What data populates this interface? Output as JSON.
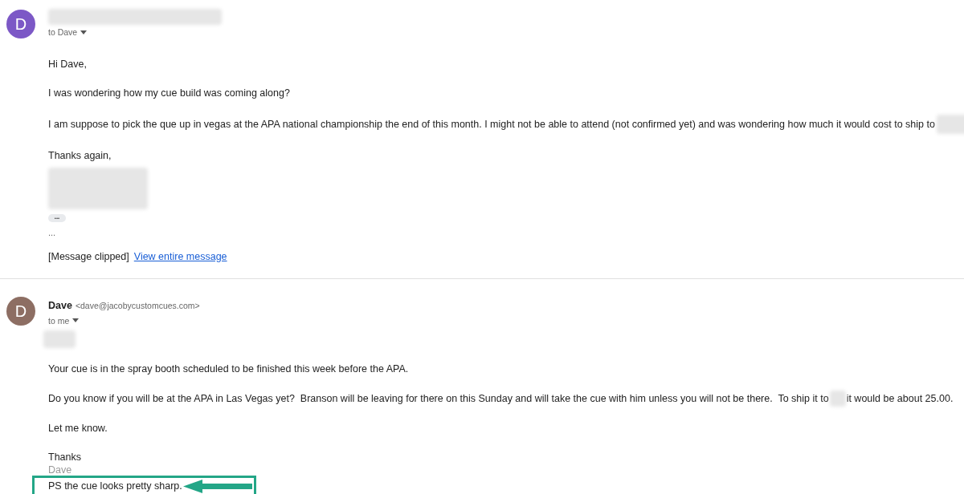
{
  "messages": [
    {
      "avatar_letter": "D",
      "color": "#7c58c6",
      "recipient": "to Dave",
      "body": [
        {
          "kind": "text",
          "text": "Hi Dave,"
        },
        {
          "kind": "text",
          "text": "I was wondering how my cue build was coming along?"
        },
        {
          "kind": "text_redacted_end",
          "before": "I am suppose to pick the que up in vegas at the APA national championship the end of this month. I might not be able to attend (not confirmed yet) and was wondering how much it would cost to ship to"
        },
        {
          "kind": "text",
          "text": "Thanks again,"
        },
        {
          "kind": "redacted_block"
        },
        {
          "kind": "dots_button",
          "text": "•••"
        },
        {
          "kind": "quoted",
          "text": "..."
        },
        {
          "kind": "clipped",
          "text": "[Message clipped]",
          "link": "View entire message"
        }
      ]
    },
    {
      "avatar_letter": "D",
      "color": "#8d6e63",
      "sender_name": "Dave",
      "sender_email": "<dave@jacobycustomcues.com>",
      "recipient": "to me",
      "body": [
        {
          "kind": "redacted_word"
        },
        {
          "kind": "text",
          "text": "Your cue is in the spray booth scheduled to be finished this week before the APA."
        },
        {
          "kind": "text_redacted_mid",
          "before": "Do you know if you will be at the APA in Las Vegas yet?  Branson will be leaving for there on this Sunday and will take the cue with him unless you will not be there.  To ship it to",
          "after": "it would be about 25.00."
        },
        {
          "kind": "text",
          "text": "Let me know."
        },
        {
          "kind": "signoff",
          "text": "Thanks"
        },
        {
          "kind": "signature",
          "text": "Dave"
        },
        {
          "kind": "highlighted",
          "text": "PS the cue looks pretty sharp."
        }
      ]
    }
  ]
}
